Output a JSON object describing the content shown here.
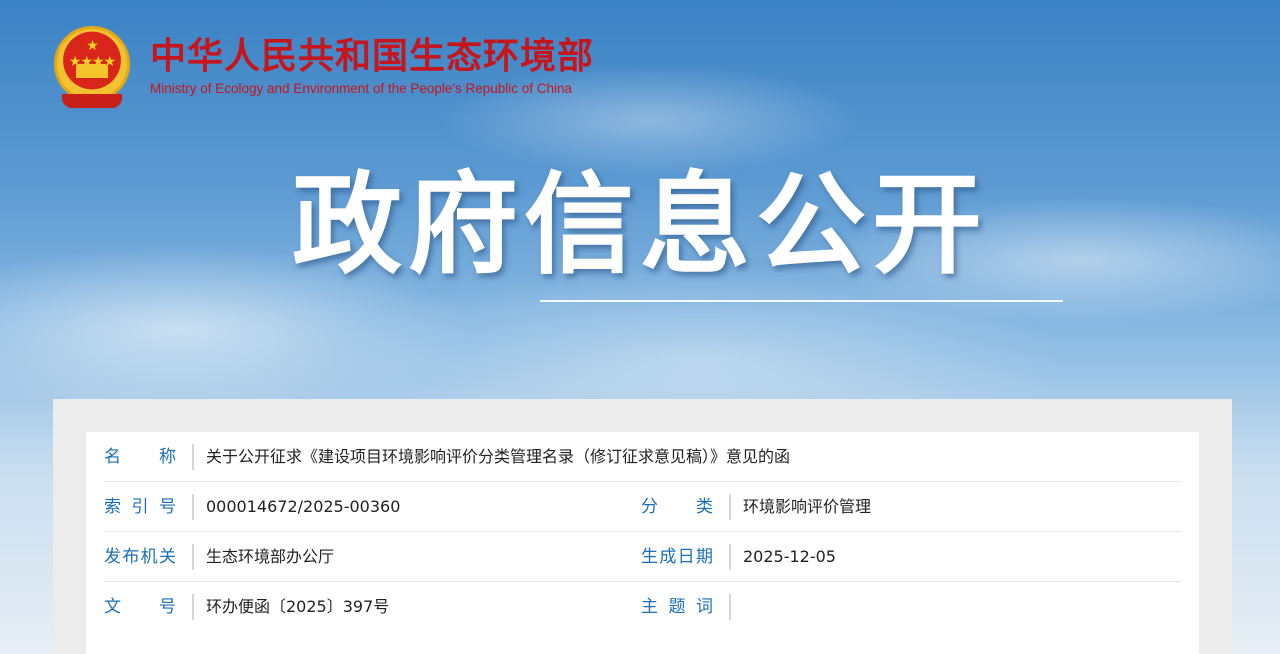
{
  "header": {
    "org_name_cn": "中华人民共和国生态环境部",
    "org_name_en": "Ministry of Ecology and Environment of the People's Republic of China"
  },
  "banner": {
    "title": "政府信息公开"
  },
  "colors": {
    "brand_red": "#c4161c",
    "label_blue": "#1c6fb6"
  },
  "info": {
    "name_label": [
      "名",
      "称"
    ],
    "name_value": "关于公开征求《建设项目环境影响评价分类管理名录（修订征求意见稿）》意见的函",
    "index_label": [
      "索",
      "引",
      "号"
    ],
    "index_value": "000014672/2025-00360",
    "category_label": [
      "分",
      "类"
    ],
    "category_value": "环境影响评价管理",
    "issuer_label": [
      "发",
      "布",
      "机",
      "关"
    ],
    "issuer_value": "生态环境部办公厅",
    "date_label": [
      "生",
      "成",
      "日",
      "期"
    ],
    "date_value": "2025-12-05",
    "doc_no_label": [
      "文",
      "号"
    ],
    "doc_no_value": "环办便函〔2025〕397号",
    "keywords_label": [
      "主",
      "题",
      "词"
    ],
    "keywords_value": ""
  }
}
